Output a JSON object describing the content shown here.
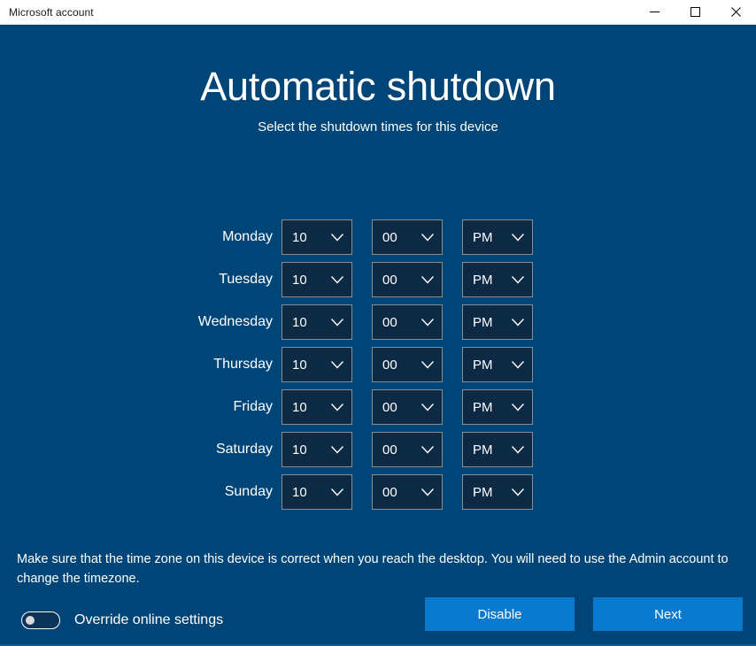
{
  "window": {
    "title": "Microsoft account",
    "controls": {
      "minimize": "Minimize",
      "maximize": "Maximize",
      "close": "Close"
    }
  },
  "page": {
    "title": "Automatic shutdown",
    "subtitle": "Select the shutdown times for this device"
  },
  "schedule": {
    "rows": [
      {
        "day": "Monday",
        "hour": "10",
        "minute": "00",
        "meridiem": "PM"
      },
      {
        "day": "Tuesday",
        "hour": "10",
        "minute": "00",
        "meridiem": "PM"
      },
      {
        "day": "Wednesday",
        "hour": "10",
        "minute": "00",
        "meridiem": "PM"
      },
      {
        "day": "Thursday",
        "hour": "10",
        "minute": "00",
        "meridiem": "PM"
      },
      {
        "day": "Friday",
        "hour": "10",
        "minute": "00",
        "meridiem": "PM"
      },
      {
        "day": "Saturday",
        "hour": "10",
        "minute": "00",
        "meridiem": "PM"
      },
      {
        "day": "Sunday",
        "hour": "10",
        "minute": "00",
        "meridiem": "PM"
      }
    ]
  },
  "note": {
    "text": "Make sure that the time zone on this device is correct when you reach the desktop. You will need to use the Admin account to change the timezone."
  },
  "footer": {
    "toggle": {
      "label": "Override online settings",
      "state": "off"
    },
    "buttons": {
      "disable": "Disable",
      "next": "Next"
    }
  },
  "colors": {
    "page_background": "#004578",
    "titlebar_background": "#ffffff",
    "combo_fill": "#0d2a45",
    "combo_border": "#8c8c8c",
    "accent_button": "#0a7ad0",
    "text_primary": "#ffffff"
  },
  "icons": {
    "chevron_down": "chevron-down-icon",
    "minimize": "minimize-icon",
    "maximize": "maximize-icon",
    "close": "close-icon"
  }
}
